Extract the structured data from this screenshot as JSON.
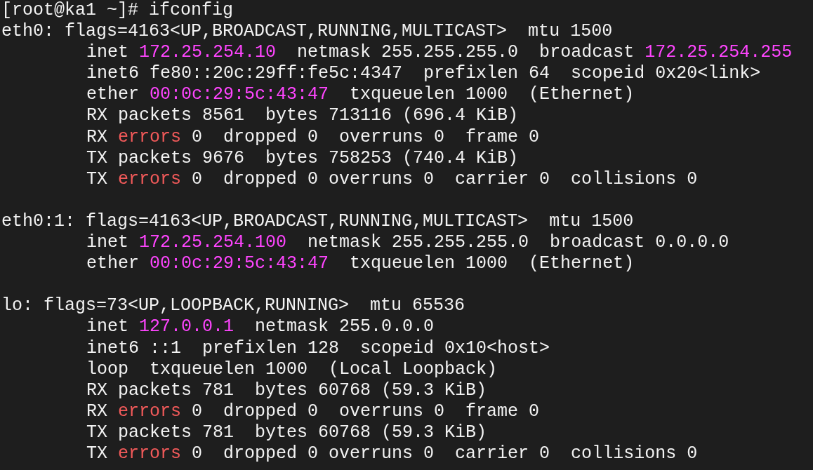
{
  "prompt": {
    "text": "[root@ka1 ~]# ifconfig"
  },
  "interfaces": [
    {
      "header": [
        {
          "kind": "text",
          "text": "eth0: flags=4163<UP,BROADCAST,RUNNING,MULTICAST>  mtu 1500"
        }
      ],
      "details": [
        [
          {
            "kind": "text",
            "text": "inet "
          },
          {
            "kind": "address",
            "text": "172.25.254.10"
          },
          {
            "kind": "text",
            "text": "  netmask 255.255.255.0  broadcast "
          },
          {
            "kind": "address",
            "text": "172.25.254.255"
          }
        ],
        [
          {
            "kind": "text",
            "text": "inet6 fe80::20c:29ff:fe5c:4347  prefixlen 64  scopeid 0x20<link>"
          }
        ],
        [
          {
            "kind": "text",
            "text": "ether "
          },
          {
            "kind": "address",
            "text": "00:0c:29:5c:43:47"
          },
          {
            "kind": "text",
            "text": "  txqueuelen 1000  (Ethernet)"
          }
        ],
        [
          {
            "kind": "text",
            "text": "RX packets 8561  bytes 713116 (696.4 KiB)"
          }
        ],
        [
          {
            "kind": "text",
            "text": "RX "
          },
          {
            "kind": "error",
            "text": "errors"
          },
          {
            "kind": "text",
            "text": " 0  dropped 0  overruns 0  frame 0"
          }
        ],
        [
          {
            "kind": "text",
            "text": "TX packets 9676  bytes 758253 (740.4 KiB)"
          }
        ],
        [
          {
            "kind": "text",
            "text": "TX "
          },
          {
            "kind": "error",
            "text": "errors"
          },
          {
            "kind": "text",
            "text": " 0  dropped 0 overruns 0  carrier 0  collisions 0"
          }
        ]
      ]
    },
    {
      "header": [
        {
          "kind": "text",
          "text": "eth0:1: flags=4163<UP,BROADCAST,RUNNING,MULTICAST>  mtu 1500"
        }
      ],
      "details": [
        [
          {
            "kind": "text",
            "text": "inet "
          },
          {
            "kind": "address",
            "text": "172.25.254.100"
          },
          {
            "kind": "text",
            "text": "  netmask 255.255.255.0  broadcast 0.0.0.0"
          }
        ],
        [
          {
            "kind": "text",
            "text": "ether "
          },
          {
            "kind": "address",
            "text": "00:0c:29:5c:43:47"
          },
          {
            "kind": "text",
            "text": "  txqueuelen 1000  (Ethernet)"
          }
        ]
      ]
    },
    {
      "header": [
        {
          "kind": "text",
          "text": "lo: flags=73<UP,LOOPBACK,RUNNING>  mtu 65536"
        }
      ],
      "details": [
        [
          {
            "kind": "text",
            "text": "inet "
          },
          {
            "kind": "address",
            "text": "127.0.0.1"
          },
          {
            "kind": "text",
            "text": "  netmask 255.0.0.0"
          }
        ],
        [
          {
            "kind": "text",
            "text": "inet6 ::1  prefixlen 128  scopeid 0x10<host>"
          }
        ],
        [
          {
            "kind": "text",
            "text": "loop  txqueuelen 1000  (Local Loopback)"
          }
        ],
        [
          {
            "kind": "text",
            "text": "RX packets 781  bytes 60768 (59.3 KiB)"
          }
        ],
        [
          {
            "kind": "text",
            "text": "RX "
          },
          {
            "kind": "error",
            "text": "errors"
          },
          {
            "kind": "text",
            "text": " 0  dropped 0  overruns 0  frame 0"
          }
        ],
        [
          {
            "kind": "text",
            "text": "TX packets 781  bytes 60768 (59.3 KiB)"
          }
        ],
        [
          {
            "kind": "text",
            "text": "TX "
          },
          {
            "kind": "error",
            "text": "errors"
          },
          {
            "kind": "text",
            "text": " 0  dropped 0 overruns 0  carrier 0  collisions 0"
          }
        ]
      ]
    }
  ]
}
